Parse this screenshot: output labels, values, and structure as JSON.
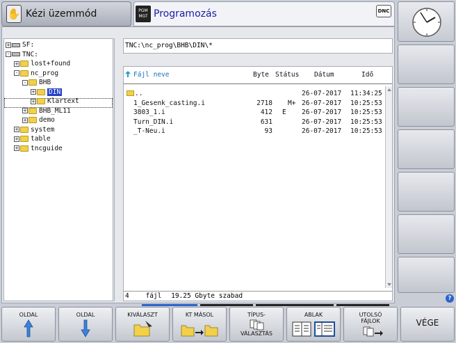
{
  "header": {
    "mode_label": "Kézi üzemmód",
    "program_label": "Programozás",
    "pgm_icon_text": "PGM MGT",
    "dnc_label": "DNC"
  },
  "tree": {
    "items": [
      {
        "label": "SF:",
        "indent": 0,
        "type": "drive",
        "expander": "+"
      },
      {
        "label": "TNC:",
        "indent": 0,
        "type": "drive",
        "expander": "-"
      },
      {
        "label": "lost+found",
        "indent": 1,
        "type": "folder",
        "expander": "+"
      },
      {
        "label": "nc_prog",
        "indent": 1,
        "type": "folder",
        "expander": "-"
      },
      {
        "label": "BHB",
        "indent": 2,
        "type": "folder",
        "expander": "-"
      },
      {
        "label": "DIN",
        "indent": 3,
        "type": "folder",
        "expander": "+",
        "selected": true
      },
      {
        "label": "Klartext",
        "indent": 3,
        "type": "folder",
        "expander": "+"
      },
      {
        "label": "BHB_ML11",
        "indent": 2,
        "type": "folder",
        "expander": "+"
      },
      {
        "label": "demo",
        "indent": 2,
        "type": "folder",
        "expander": "+"
      },
      {
        "label": "system",
        "indent": 1,
        "type": "folder",
        "expander": "+"
      },
      {
        "label": "table",
        "indent": 1,
        "type": "folder",
        "expander": "+"
      },
      {
        "label": "tncguide",
        "indent": 1,
        "type": "folder",
        "expander": "+"
      }
    ]
  },
  "path": "TNC:\\nc_prog\\BHB\\DIN\\*",
  "columns": {
    "name": "Fájl neve",
    "byte": "Byte",
    "status": "Státus",
    "date": "Dátum",
    "time": "Idő"
  },
  "files": [
    {
      "name": "..",
      "byte": "",
      "status": "",
      "date": "26-07-2017",
      "time": "11:34:25",
      "folder": true
    },
    {
      "name": "1_Gesenk_casting.i",
      "byte": "2718",
      "status": "M+",
      "date": "26-07-2017",
      "time": "10:25:53"
    },
    {
      "name": "3803_1.i",
      "byte": "412",
      "status": "E",
      "date": "26-07-2017",
      "time": "10:25:53"
    },
    {
      "name": "Turn_DIN.i",
      "byte": "631",
      "status": "",
      "date": "26-07-2017",
      "time": "10:25:53"
    },
    {
      "name": "_T-Neu.i",
      "byte": "93",
      "status": "",
      "date": "26-07-2017",
      "time": "10:25:53"
    }
  ],
  "status_bar": {
    "count": "4",
    "unit": "fájl",
    "free": "19.25 Gbyte szabad"
  },
  "softkeys": {
    "oldal_up": "OLDAL",
    "oldal_down": "OLDAL",
    "kivalaszt": "KIVÁLASZT",
    "kt_masol": "KT MÁSOL",
    "tipus_line1": "TÍPUS-",
    "tipus_line2": "VÁLASZTÁS",
    "ablak": "ABLAK",
    "utolso_line1": "UTOLSÓ",
    "utolso_line2": "FÁJLOK",
    "vege": "VÉGE"
  },
  "help_icon": "?",
  "colors": {
    "accent": "#2440c8",
    "program_text": "#1a1aa6",
    "pager_active": "#2b63c8"
  }
}
